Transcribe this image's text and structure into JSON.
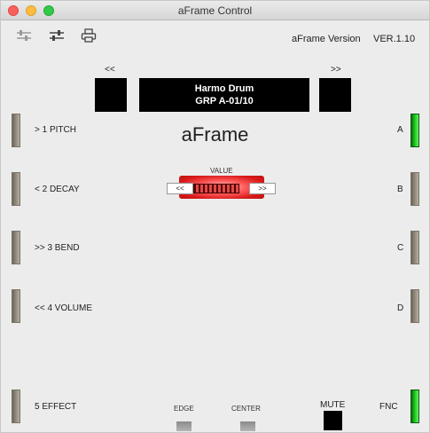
{
  "window": {
    "title": "aFrame Control"
  },
  "toolbar": {
    "icons": [
      "sliders-left-icon",
      "sliders-right-icon",
      "printer-icon"
    ],
    "version_label": "aFrame Version",
    "version_value": "VER.1.10"
  },
  "nav": {
    "prev_label": "<<",
    "next_label": ">>"
  },
  "display": {
    "line1": "Harmo Drum",
    "line2": "GRP A-01/10"
  },
  "brand": "aFrame",
  "left_controls": [
    {
      "label": "> 1 PITCH"
    },
    {
      "label": "< 2 DECAY"
    },
    {
      "label": ">> 3 BEND"
    },
    {
      "label": "<< 4 VOLUME"
    },
    {
      "label": "5 EFFECT"
    }
  ],
  "right_controls": [
    {
      "label": "A",
      "active": true
    },
    {
      "label": "B",
      "active": false
    },
    {
      "label": "C",
      "active": false
    },
    {
      "label": "D",
      "active": false
    },
    {
      "label": "FNC",
      "active": true
    }
  ],
  "value_control": {
    "label": "VALUE",
    "dec_label": "<<",
    "inc_label": ">>"
  },
  "bottom": {
    "edge_label": "EDGE",
    "center_label": "CENTER",
    "mute_label": "MUTE"
  },
  "colors": {
    "active_green": "#18c418",
    "knob_red": "#d81a1a",
    "button_taupe": "#8f877a"
  }
}
